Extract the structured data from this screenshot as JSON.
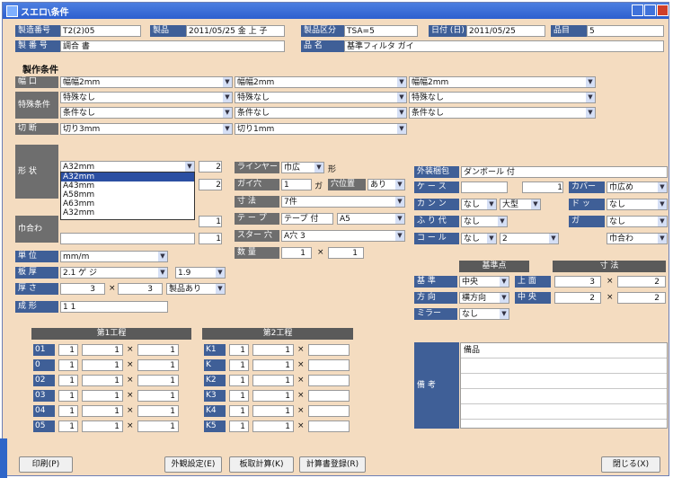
{
  "window": {
    "title": "スエロ\\条件",
    "colors": {
      "title_bar": "#2d5fcf",
      "body": "#f4dcc0",
      "label": "#6e6e6e",
      "label_blue": "#3f5f97"
    }
  },
  "header": {
    "row1": [
      {
        "label": "製造番号",
        "value": "T2(2)05"
      },
      {
        "label": "製品",
        "value": "2011/05/25 金 上 子"
      },
      {
        "label": "製品区分",
        "value": "TSA=5"
      },
      {
        "label": "日付 (日)",
        "value": "2011/05/25"
      },
      {
        "label": "品目",
        "value": "5"
      }
    ],
    "row2": [
      {
        "label": "製 番 号",
        "value": "調合 書"
      },
      {
        "label": "品  名",
        "value": "基準フィルタ ガイ"
      }
    ]
  },
  "section_title": "製作条件",
  "conditions": [
    {
      "label": "幅 口",
      "values": [
        "幅幅2mm",
        "幅幅2mm",
        "幅幅2mm"
      ]
    },
    {
      "label": "特殊条件",
      "values": [
        "特殊なし",
        "特殊なし",
        "特殊なし"
      ]
    },
    {
      "label": "",
      "values": [
        "条件なし",
        "条件なし",
        "条件なし"
      ]
    },
    {
      "label": "切 断",
      "values": [
        "切り3mm",
        "切り1mm",
        ""
      ]
    }
  ],
  "mid_left": {
    "label_a": "形 状",
    "dropdown_value": "A32mm",
    "list_options": [
      "A32mm",
      "A43mm",
      "A58mm",
      "A63mm",
      "A32mm"
    ],
    "label_b": "巾合わ",
    "num1": "2",
    "num2": "2",
    "num3": "1",
    "num4": "1"
  },
  "mid_center": [
    {
      "label": "ラインヤード",
      "value": "巾広",
      "extra": "形"
    },
    {
      "label": "ガイ穴",
      "value": "1",
      "extra": "ガ",
      "label2": "穴位置",
      "value2": "あり"
    },
    {
      "label": "寸 法",
      "value": "7件"
    },
    {
      "label": "テ ー プ",
      "value": "テープ 付",
      "value2": "A5"
    },
    {
      "label": "スター 穴",
      "value": "A穴 3"
    }
  ],
  "mid_right": [
    {
      "label": "外装梱包",
      "value": "ダンボール 付"
    },
    {
      "label": "ケ ー ス",
      "value": "1",
      "label2": "カバー",
      "value2": "巾広め"
    },
    {
      "label": "カ ン ン",
      "value": "なし",
      "value2": "大型",
      "label2": "ド ッ",
      "value3": "なし"
    },
    {
      "label": "ふ り 代",
      "value": "なし",
      "label2": "ガ",
      "value2": "なし"
    },
    {
      "label": "コ ー ル",
      "value": "なし",
      "value2": "2",
      "value3": "巾合わ"
    }
  ],
  "lower_left": [
    {
      "label": "単 位",
      "value": "mm/m"
    },
    {
      "label": "板 厚",
      "value": "2.1 ゲ ジ",
      "value2": "1.9"
    },
    {
      "label": "厚 さ",
      "value": "3",
      "value2": "3",
      "select": "製品あり"
    },
    {
      "label": "成 形",
      "value": "1 1"
    }
  ],
  "center_small": {
    "label": "数 量",
    "value1": "1",
    "value2": "1"
  },
  "table_r": {
    "headers": [
      "基準点",
      "寸 法"
    ],
    "rows": [
      {
        "label": "基 準",
        "select": "中央",
        "label2": "上 面",
        "a": "3",
        "b": "2"
      },
      {
        "label": "方 向",
        "select": "横方向",
        "label2": "中 央",
        "a": "2",
        "b": "2"
      },
      {
        "label": "ミラー",
        "select": "なし"
      }
    ]
  },
  "grid1": {
    "title": "第1工程",
    "rows": [
      {
        "label": "01",
        "a": "1",
        "b": "1",
        "c": "1"
      },
      {
        "label": "0",
        "a": "1",
        "b": "1",
        "c": "1"
      },
      {
        "label": "02",
        "a": "1",
        "b": "1",
        "c": "1"
      },
      {
        "label": "03",
        "a": "1",
        "b": "1",
        "c": "1"
      },
      {
        "label": "04",
        "a": "1",
        "b": "1",
        "c": "1"
      },
      {
        "label": "05",
        "a": "1",
        "b": "1",
        "c": "1"
      }
    ]
  },
  "grid2": {
    "title": "第2工程",
    "rows": [
      {
        "label": "K1",
        "a": "1",
        "b": "1",
        "c": ""
      },
      {
        "label": "K",
        "a": "1",
        "b": "1",
        "c": ""
      },
      {
        "label": "K2",
        "a": "1",
        "b": "1",
        "c": ""
      },
      {
        "label": "K3",
        "a": "1",
        "b": "1",
        "c": ""
      },
      {
        "label": "K4",
        "a": "1",
        "b": "1",
        "c": ""
      },
      {
        "label": "K5",
        "a": "1",
        "b": "1",
        "c": ""
      }
    ]
  },
  "memo": {
    "label": "備 考",
    "lines": [
      "備品",
      "",
      "",
      "",
      "",
      ""
    ]
  },
  "buttons": {
    "print": "印刷(P)",
    "copy": "外観設定(E)",
    "calc": "板取計算(K)",
    "register": "計算書登録(R)",
    "close": "閉じる(X)"
  }
}
